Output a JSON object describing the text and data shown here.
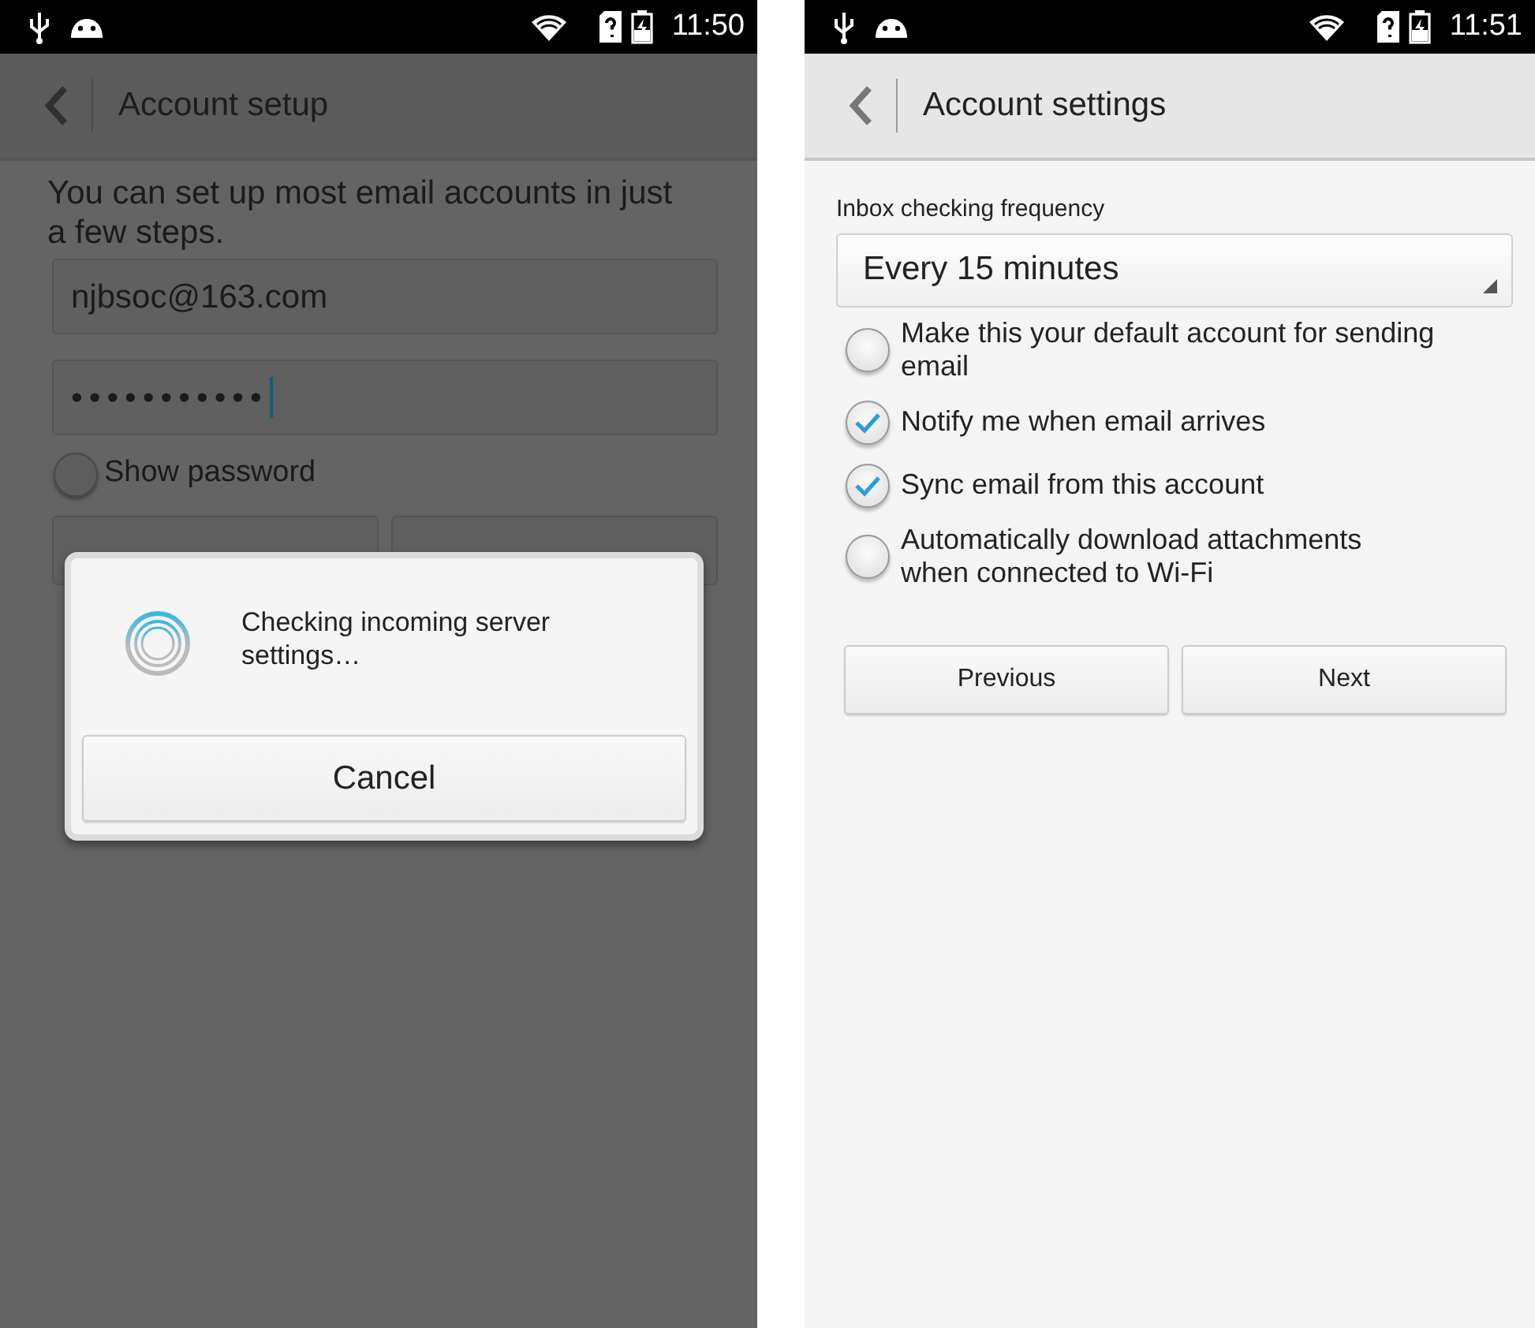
{
  "setup_screen": {
    "status_bar": {
      "time": "11:50"
    },
    "title": "Account setup",
    "intro": "You can set up most email accounts in just a few steps.",
    "email": {
      "value": "njbsoc@163.com"
    },
    "password": {
      "value": "•••••••••••"
    },
    "show_password": {
      "label": "Show password",
      "checked": false
    },
    "dialog": {
      "message": "Checking incoming server settings…",
      "button": "Cancel"
    }
  },
  "settings_screen": {
    "status_bar": {
      "time": "11:51"
    },
    "title": "Account settings",
    "frequency_label": "Inbox checking frequency",
    "frequency_value": "Every 15 minutes",
    "options": [
      {
        "label": "Make this your default account for sending email",
        "checked": false
      },
      {
        "label": "Notify me when email arrives",
        "checked": true
      },
      {
        "label": "Sync email from this account",
        "checked": true
      },
      {
        "label": "Automatically download attachments when connected to Wi-Fi",
        "checked": false
      }
    ],
    "buttons": [
      "Previous",
      "Next"
    ]
  }
}
